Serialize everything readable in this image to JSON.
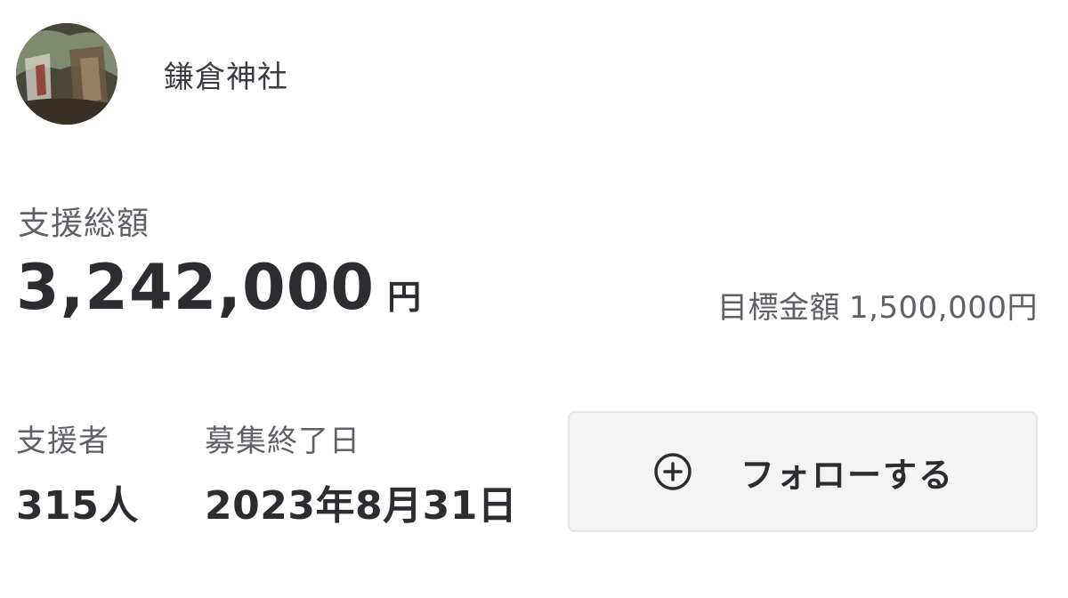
{
  "organization": {
    "name": "鎌倉神社",
    "avatar_icon": "organization-avatar"
  },
  "support_total": {
    "label": "支援総額",
    "amount": "3,242,000",
    "unit": "円"
  },
  "goal": {
    "label": "目標金額",
    "amount": "1,500,000円"
  },
  "supporters": {
    "label": "支援者",
    "value": "315人"
  },
  "end_date": {
    "label": "募集終了日",
    "value": "2023年8月31日"
  },
  "follow_button": {
    "label": "フォローする",
    "icon": "plus-circle-icon"
  },
  "colors": {
    "text_primary": "#2b2d31",
    "text_secondary": "#5f6166",
    "button_bg": "#f4f4f5",
    "button_border": "#e3e4e7"
  }
}
